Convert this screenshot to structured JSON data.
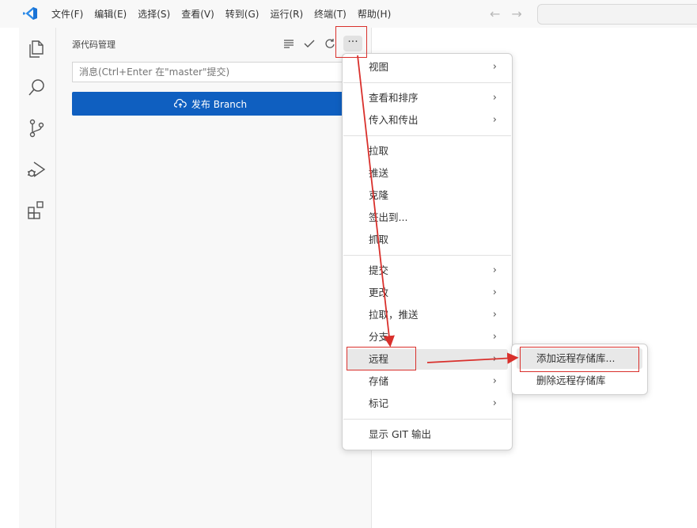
{
  "menubar": {
    "items": [
      "文件(F)",
      "编辑(E)",
      "选择(S)",
      "查看(V)",
      "转到(G)",
      "运行(R)",
      "终端(T)",
      "帮助(H)"
    ]
  },
  "nav": {
    "back": "←",
    "forward": "→"
  },
  "activity_bar": {
    "icons": [
      "explorer-icon",
      "search-icon",
      "source-control-icon",
      "run-debug-icon",
      "extensions-icon"
    ]
  },
  "sidebar": {
    "title": "源代码管理",
    "more": "···",
    "message_placeholder": "消息(Ctrl+Enter 在\"master\"提交)",
    "publish_label": "发布 Branch"
  },
  "context_menu": {
    "items": [
      {
        "label": "视图",
        "submenu": true
      },
      {
        "label": "查看和排序",
        "submenu": true
      },
      {
        "label": "传入和传出",
        "submenu": true
      },
      {
        "label": "拉取",
        "submenu": false
      },
      {
        "label": "推送",
        "submenu": false
      },
      {
        "label": "克隆",
        "submenu": false
      },
      {
        "label": "签出到...",
        "submenu": false
      },
      {
        "label": "抓取",
        "submenu": false
      },
      {
        "label": "提交",
        "submenu": true
      },
      {
        "label": "更改",
        "submenu": true
      },
      {
        "label": "拉取，推送",
        "submenu": true
      },
      {
        "label": "分支",
        "submenu": true
      },
      {
        "label": "远程",
        "submenu": true,
        "highlighted": true
      },
      {
        "label": "存储",
        "submenu": true
      },
      {
        "label": "标记",
        "submenu": true
      },
      {
        "label": "显示 GIT 输出",
        "submenu": false
      }
    ],
    "chevron": "›"
  },
  "remote_submenu": {
    "items": [
      {
        "label": "添加远程存储库...",
        "highlighted": true
      },
      {
        "label": "删除远程存储库",
        "highlighted": false
      }
    ]
  },
  "colors": {
    "accent_button": "#0f5fc0",
    "annotation": "#d9302c",
    "vscode_logo": "#1a73d6"
  }
}
